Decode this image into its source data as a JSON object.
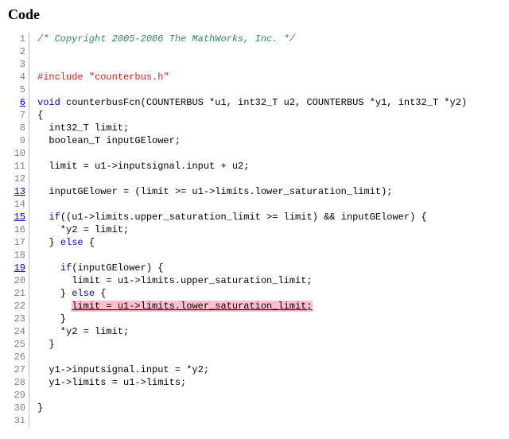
{
  "title": "Code",
  "lines": [
    {
      "n": 1,
      "link": false,
      "tokens": [
        {
          "cls": "c-comment",
          "text": "/* Copyright 2005-2006 The MathWorks, Inc. */"
        }
      ]
    },
    {
      "n": 2,
      "link": false,
      "tokens": []
    },
    {
      "n": 3,
      "link": false,
      "tokens": []
    },
    {
      "n": 4,
      "link": false,
      "tokens": [
        {
          "cls": "c-pre",
          "text": "#include \"counterbus.h\""
        }
      ]
    },
    {
      "n": 5,
      "link": false,
      "tokens": []
    },
    {
      "n": 6,
      "link": true,
      "tokens": [
        {
          "cls": "c-kw",
          "text": "void"
        },
        {
          "cls": "c-plain",
          "text": " counterbusFcn(COUNTERBUS *u1, int32_T u2, COUNTERBUS *y1, int32_T *y2)"
        }
      ]
    },
    {
      "n": 7,
      "link": false,
      "tokens": [
        {
          "cls": "c-plain",
          "text": "{"
        }
      ]
    },
    {
      "n": 8,
      "link": false,
      "tokens": [
        {
          "cls": "c-plain",
          "text": "  int32_T limit;"
        }
      ]
    },
    {
      "n": 9,
      "link": false,
      "tokens": [
        {
          "cls": "c-plain",
          "text": "  boolean_T inputGElower;"
        }
      ]
    },
    {
      "n": 10,
      "link": false,
      "tokens": []
    },
    {
      "n": 11,
      "link": false,
      "tokens": [
        {
          "cls": "c-plain",
          "text": "  limit = u1->inputsignal.input + u2;"
        }
      ]
    },
    {
      "n": 12,
      "link": false,
      "tokens": []
    },
    {
      "n": 13,
      "link": true,
      "tokens": [
        {
          "cls": "c-plain",
          "text": "  inputGElower = (limit >= u1->limits.lower_saturation_limit);"
        }
      ]
    },
    {
      "n": 14,
      "link": false,
      "tokens": []
    },
    {
      "n": 15,
      "link": true,
      "tokens": [
        {
          "cls": "c-plain",
          "text": "  "
        },
        {
          "cls": "c-kw",
          "text": "if"
        },
        {
          "cls": "c-plain",
          "text": "((u1->limits.upper_saturation_limit >= limit) && inputGElower) {"
        }
      ]
    },
    {
      "n": 16,
      "link": false,
      "tokens": [
        {
          "cls": "c-plain",
          "text": "    *y2 = limit;"
        }
      ]
    },
    {
      "n": 17,
      "link": false,
      "tokens": [
        {
          "cls": "c-plain",
          "text": "  } "
        },
        {
          "cls": "c-kw",
          "text": "else"
        },
        {
          "cls": "c-plain",
          "text": " {"
        }
      ]
    },
    {
      "n": 18,
      "link": false,
      "tokens": []
    },
    {
      "n": 19,
      "link": true,
      "tokens": [
        {
          "cls": "c-plain",
          "text": "    "
        },
        {
          "cls": "c-kw",
          "text": "if"
        },
        {
          "cls": "c-plain",
          "text": "(inputGElower) {"
        }
      ]
    },
    {
      "n": 20,
      "link": false,
      "tokens": [
        {
          "cls": "c-plain",
          "text": "      limit = u1->limits.upper_saturation_limit;"
        }
      ]
    },
    {
      "n": 21,
      "link": false,
      "tokens": [
        {
          "cls": "c-plain",
          "text": "    } "
        },
        {
          "cls": "c-kw",
          "text": "else"
        },
        {
          "cls": "c-plain",
          "text": " {"
        }
      ]
    },
    {
      "n": 22,
      "link": false,
      "tokens": [
        {
          "cls": "c-plain",
          "text": "      "
        },
        {
          "cls": "hl",
          "text": "limit = u1->limits.lower_saturation_limit;"
        }
      ]
    },
    {
      "n": 23,
      "link": false,
      "tokens": [
        {
          "cls": "c-plain",
          "text": "    }"
        }
      ]
    },
    {
      "n": 24,
      "link": false,
      "tokens": [
        {
          "cls": "c-plain",
          "text": "    *y2 = limit;"
        }
      ]
    },
    {
      "n": 25,
      "link": false,
      "tokens": [
        {
          "cls": "c-plain",
          "text": "  }"
        }
      ]
    },
    {
      "n": 26,
      "link": false,
      "tokens": []
    },
    {
      "n": 27,
      "link": false,
      "tokens": [
        {
          "cls": "c-plain",
          "text": "  y1->inputsignal.input = *y2;"
        }
      ]
    },
    {
      "n": 28,
      "link": false,
      "tokens": [
        {
          "cls": "c-plain",
          "text": "  y1->limits = u1->limits;"
        }
      ]
    },
    {
      "n": 29,
      "link": false,
      "tokens": []
    },
    {
      "n": 30,
      "link": false,
      "tokens": [
        {
          "cls": "c-plain",
          "text": "}"
        }
      ]
    },
    {
      "n": 31,
      "link": false,
      "tokens": []
    }
  ]
}
